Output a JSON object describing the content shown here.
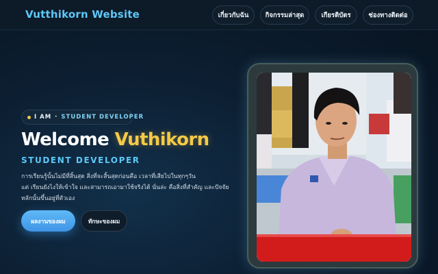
{
  "brand": "Vutthikorn Website",
  "nav": [
    {
      "label": "เกี่ยวกับฉัน"
    },
    {
      "label": "กิจกรรมล่าสุด"
    },
    {
      "label": "เกียรติบัตร"
    },
    {
      "label": "ช่องทางติดต่อ"
    }
  ],
  "hero": {
    "pill_prefix": "I AM",
    "pill_sep": "·",
    "pill_role": "STUDENT DEVELOPER",
    "headline_white": "Welcome",
    "headline_gold": "Vuthikorn",
    "subheading": "STUDENT DEVELOPER",
    "description": [
      "การเรียนรู้นั้นไม่มีที่สิ้นสุด สิ่งที่จะสิ้นสุดก่อนคือ เวลาที่เสียไปในทุกๆวัน",
      "แต่ เรียนยังไงให้เข้าใจ และสามารถเอามาใช้จริงได้ นั่นล่ะ คือสิ่งที่สำคัญ และปัจจัย",
      "หลักนั้นขึ้นอยู่ที่ตัวเอง"
    ],
    "primary_button": "ผลงานของผม",
    "secondary_button": "ทักษะของผม"
  },
  "colors": {
    "accent": "#5cc8f7",
    "gold": "#f5c948",
    "button": "#4aa5ee",
    "background": "#0c1e31"
  },
  "icons": [
    "dot-icon"
  ]
}
